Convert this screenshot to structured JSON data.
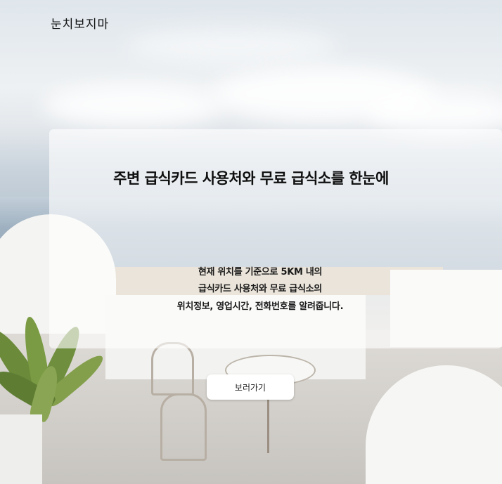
{
  "header": {
    "brand": "눈치보지마"
  },
  "hero": {
    "headline": "주변 급식카드 사용처와 무료 급식소를 한눈에",
    "description": [
      "현재 위치를 기준으로 5KM 내의",
      "급식카드 사용처와 무료 급식소의",
      "위치정보, 영업시간, 전화번호를 알려줍니다."
    ],
    "cta_label": "보러가기"
  }
}
